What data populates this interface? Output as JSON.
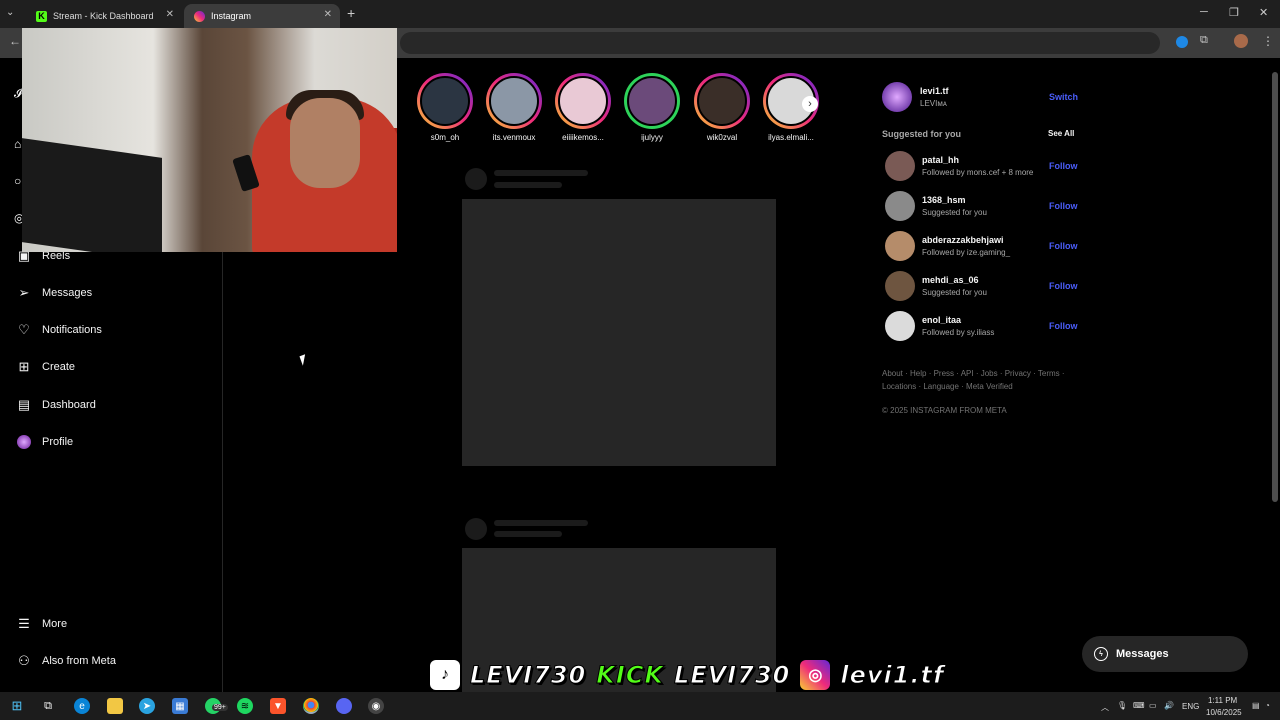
{
  "browser": {
    "tabs": [
      {
        "label": "Stream - Kick Dashboard",
        "icon": "kick-logo",
        "active": false
      },
      {
        "label": "Instagram",
        "icon": "instagram-logo",
        "active": true
      }
    ],
    "new_tab": "+",
    "tab_menu": "⌄"
  },
  "nav": {
    "items": [
      {
        "label": "Reels",
        "icon": "reels-icon"
      },
      {
        "label": "Messages",
        "icon": "messages-icon"
      },
      {
        "label": "Notifications",
        "icon": "heart-icon"
      },
      {
        "label": "Create",
        "icon": "plus-square-icon"
      },
      {
        "label": "Dashboard",
        "icon": "dashboard-icon"
      },
      {
        "label": "Profile",
        "icon": "profile-avatar"
      }
    ],
    "bottom": [
      {
        "label": "More",
        "icon": "menu-icon"
      },
      {
        "label": "Also from Meta",
        "icon": "meta-grid-icon"
      }
    ]
  },
  "stories": [
    {
      "name": "s0m_oh",
      "ring": "gradient",
      "color": "#2b3542"
    },
    {
      "name": "its.venmoux",
      "ring": "gradient",
      "color": "#8b97a6"
    },
    {
      "name": "eiiiikemos...",
      "ring": "gradient",
      "color": "#e9c9d5"
    },
    {
      "name": "ijulyyy",
      "ring": "close-friends",
      "color": "#6b4a7a"
    },
    {
      "name": "wik0zval",
      "ring": "gradient",
      "color": "#3a2e28"
    },
    {
      "name": "ilyas.elmali...",
      "ring": "gradient",
      "color": "#d9d9d9"
    }
  ],
  "account": {
    "username": "levi1.tf",
    "display_name": "LEVIᴍᴀ",
    "switch_label": "Switch"
  },
  "suggested": {
    "heading": "Suggested for you",
    "see_all": "See All",
    "users": [
      {
        "username": "patal_hh",
        "subtitle": "Followed by mons.cef + 8 more",
        "follow": "Follow",
        "color": "#7a5a55"
      },
      {
        "username": "1368_hsm",
        "subtitle": "Suggested for you",
        "follow": "Follow",
        "color": "#8a8a8a"
      },
      {
        "username": "abderazzakbehjawi",
        "subtitle": "Followed by ize.gaming_",
        "follow": "Follow",
        "color": "#b58c6a"
      },
      {
        "username": "mehdi_as_06",
        "subtitle": "Suggested for you",
        "follow": "Follow",
        "color": "#6e5540"
      },
      {
        "username": "enol_itaa",
        "subtitle": "Followed by sy.iliass",
        "follow": "Follow",
        "color": "#dbdbdb"
      }
    ]
  },
  "footer": {
    "line1": "About · Help · Press · API · Jobs · Privacy · Terms ·",
    "line2": "Locations · Language · Meta Verified",
    "copyright": "© 2025 INSTAGRAM FROM META"
  },
  "messages_pill": {
    "label": "Messages"
  },
  "overlay": {
    "tiktok_handle": "LEVI730",
    "kick_label": "KICK",
    "kick_handle": "LEVI730",
    "instagram_handle": "levi1.tf"
  },
  "taskbar": {
    "time": "1:11 PM",
    "date": "10/6/2025",
    "lang": "ENG",
    "whatsapp_badge": "99+"
  },
  "colors": {
    "accent_blue": "#4a5df9",
    "kick_green": "#53fc18",
    "background": "#000000"
  }
}
